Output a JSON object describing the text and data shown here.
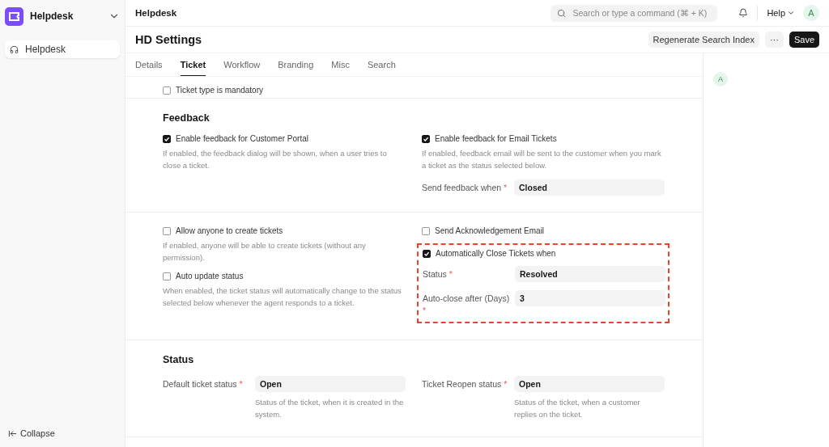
{
  "sidebar": {
    "app": "Helpdesk",
    "items": [
      {
        "label": "Helpdesk",
        "selected": true
      }
    ],
    "collapse": "Collapse"
  },
  "topbar": {
    "breadcrumb": "Helpdesk",
    "search": {
      "placeholder": "Search or type a command (⌘ + K)"
    },
    "help": "Help",
    "avatar": "A"
  },
  "page": {
    "title": "HD Settings",
    "actions": [
      {
        "label": "Regenerate Search Index",
        "kind": "secondary"
      },
      {
        "label": "···",
        "kind": "more"
      },
      {
        "label": "Save",
        "kind": "primary"
      }
    ]
  },
  "tabs": [
    {
      "label": "Details",
      "selected": false
    },
    {
      "label": "Ticket",
      "selected": true
    },
    {
      "label": "Workflow",
      "selected": false
    },
    {
      "label": "Branding",
      "selected": false
    },
    {
      "label": "Misc",
      "selected": false
    },
    {
      "label": "Search",
      "selected": false
    }
  ],
  "sections": [
    {
      "columns": [
        [
          {
            "kind": "checkbox",
            "label": "Ticket type is mandatory",
            "checked": false
          }
        ]
      ]
    },
    {
      "title": "Feedback",
      "columns": [
        [
          {
            "kind": "checkbox",
            "label": "Enable feedback for Customer Portal",
            "checked": true,
            "description": "If enabled, the feedback dialog will be shown, when a user tries to close a ticket."
          }
        ],
        [
          {
            "kind": "checkbox",
            "label": "Enable feedback for Email Tickets",
            "checked": true,
            "description": "If enabled, feedback email will be sent to the customer when you mark a ticket as the status selected below."
          },
          {
            "kind": "field",
            "label": "Send feedback when",
            "required_mark": "*",
            "value": "Closed"
          }
        ]
      ]
    },
    {
      "columns": [
        [
          {
            "kind": "checkbox",
            "label": "Allow anyone to create tickets",
            "checked": false,
            "description": "If enabled, anyone will be able to create tickets (without any permission)."
          },
          {
            "kind": "checkbox",
            "label": "Auto update status",
            "checked": false,
            "description": "When enabled, the ticket status will automatically change to the status selected below whenever the agent responds to a ticket."
          }
        ],
        [
          {
            "kind": "checkbox",
            "label": "Send Acknowledgement Email",
            "checked": false
          },
          {
            "kind": "group",
            "highlighted": true,
            "items": [
              {
                "kind": "checkbox",
                "label": "Automatically Close Tickets when",
                "checked": true
              },
              {
                "kind": "field",
                "label": "Status",
                "required_mark": "*",
                "value": "Resolved"
              },
              {
                "kind": "field",
                "label": "Auto-close after (Days)",
                "required_mark": "*",
                "value": "3"
              }
            ]
          }
        ]
      ]
    },
    {
      "title": "Status",
      "columns": [
        [
          {
            "kind": "field",
            "label": "Default ticket status",
            "required_mark": "*",
            "value": "Open",
            "description": "Status of the ticket, when it is created in the system."
          }
        ],
        [
          {
            "kind": "field",
            "label": "Ticket Reopen status",
            "required_mark": "*",
            "value": "Open",
            "description": "Status of the ticket, when a customer replies on the ticket."
          }
        ]
      ]
    }
  ],
  "activity_panel": {
    "avatar": "A"
  }
}
